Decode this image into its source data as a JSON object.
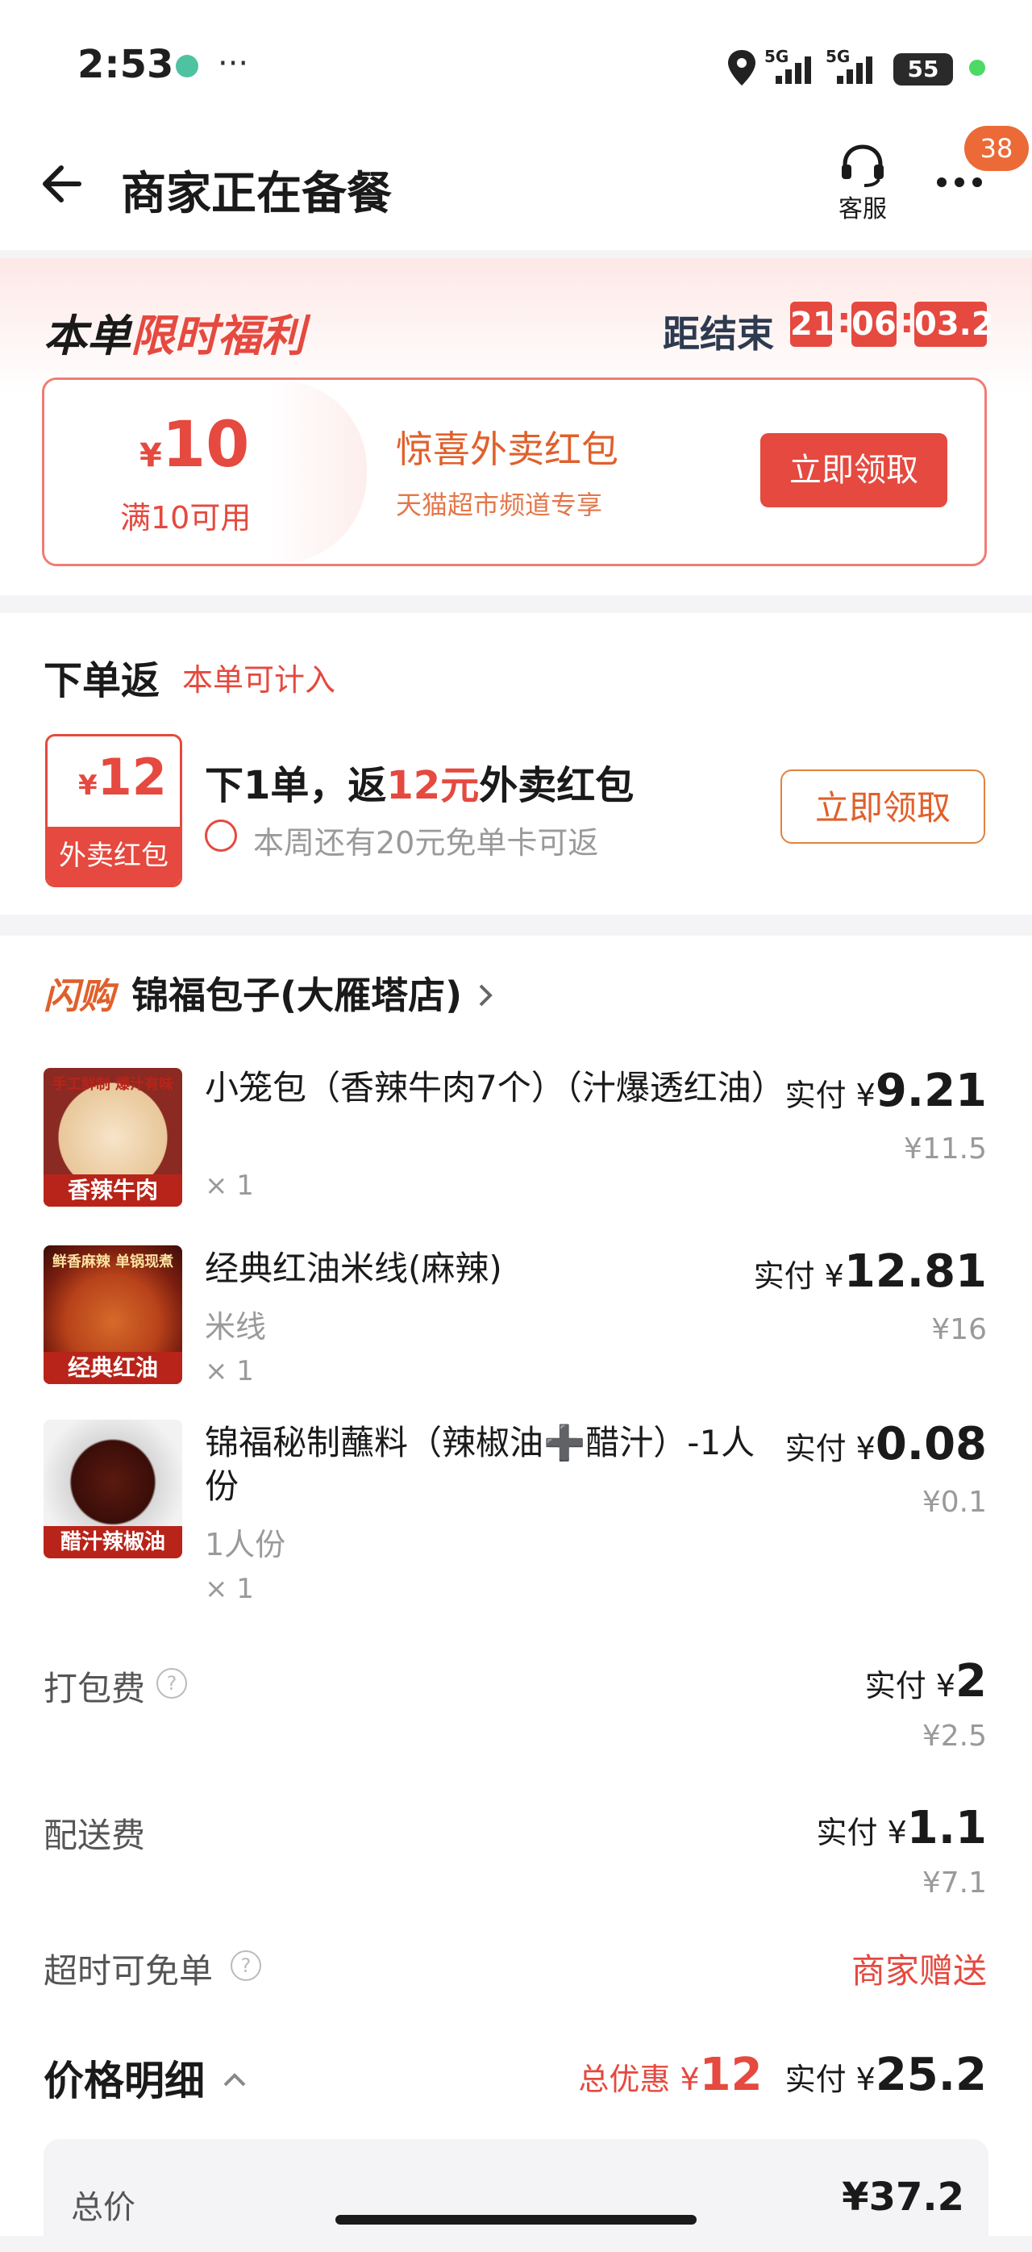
{
  "status_bar": {
    "time": "2:53",
    "dots": "···",
    "net1": "5G",
    "net2": "5G",
    "battery": "55"
  },
  "header": {
    "title": "商家正在备餐",
    "service_label": "客服",
    "badge_count": "38"
  },
  "promo": {
    "title_part1": "本单",
    "title_part2": "限时福利",
    "countdown_label": "距结束",
    "countdown_h": "21",
    "countdown_m": "06",
    "countdown_s": "03.2",
    "coupon_currency": "¥",
    "coupon_amount": "10",
    "coupon_condition": "满10可用",
    "coupon_title": "惊喜外卖红包",
    "coupon_subtitle": "天猫超市频道专享",
    "coupon_button": "立即领取"
  },
  "cashback": {
    "title": "下单返",
    "tag": "本单可计入",
    "badge_currency": "¥",
    "badge_amount": "12",
    "badge_label": "外卖红包",
    "line_prefix": "下1单，返",
    "line_highlight": "12元",
    "line_suffix": "外卖红包",
    "subline": "本周还有20元免单卡可返",
    "button": "立即领取"
  },
  "store": {
    "flash_tag": "闪购",
    "name": "锦福包子(大雁塔店)"
  },
  "items": [
    {
      "name": "小笼包（香辣牛肉7个）（汁爆透红油）",
      "spec": "",
      "qty": "× 1",
      "paid_label": "实付 ¥",
      "paid": "9.21",
      "orig": "¥11.5",
      "thumb_top": "手工鲜制 爆汁有味",
      "thumb_label": "香辣牛肉"
    },
    {
      "name": "经典红油米线(麻辣)",
      "spec": "米线",
      "qty": "× 1",
      "paid_label": "实付 ¥",
      "paid": "12.81",
      "orig": "¥16",
      "thumb_top": "鲜香麻辣 单锅现煮",
      "thumb_label": "经典红油"
    },
    {
      "name": "锦福秘制蘸料（辣椒油➕醋汁）-1人份",
      "spec": "1人份",
      "qty": "× 1",
      "paid_label": "实付 ¥",
      "paid": "0.08",
      "orig": "¥0.1",
      "thumb_top": "",
      "thumb_label": "醋汁辣椒油"
    }
  ],
  "fees": {
    "packing_label": "打包费",
    "packing_paid_label": "实付 ¥",
    "packing_paid": "2",
    "packing_orig": "¥2.5",
    "delivery_label": "配送费",
    "delivery_paid_label": "实付 ¥",
    "delivery_paid": "1.1",
    "delivery_orig": "¥7.1",
    "overtime_label": "超时可免单",
    "overtime_value": "商家赠送"
  },
  "price_detail": {
    "title": "价格明细",
    "discount_label": "总优惠 ¥",
    "discount": "12",
    "paid_label": "实付 ¥",
    "paid": "25.2",
    "partial_row_label": "总价",
    "partial_row_value": "¥37.2"
  },
  "colors": {
    "accent_red": "#e5493f",
    "promo_orange": "#e0602b",
    "text_dark": "#1a1a1a",
    "muted": "#9a9a9a"
  }
}
